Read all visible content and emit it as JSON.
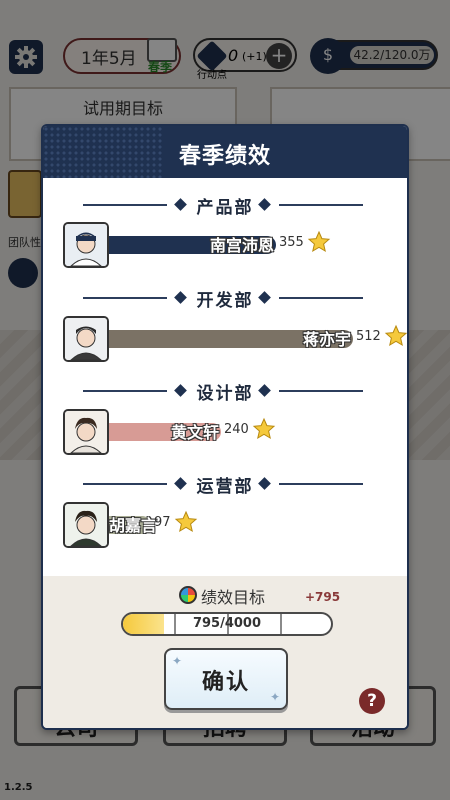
{
  "topbar": {
    "date": "1年5月",
    "season": "春季",
    "points": {
      "value": "0",
      "increment": "(+1)",
      "label": "行动点"
    },
    "money": "42.2/120.0万"
  },
  "goal_card": {
    "title": "试用期目标"
  },
  "side": {
    "label": "团队性"
  },
  "bottom_nav": [
    "公司",
    "招聘",
    "活动"
  ],
  "version": "1.2.5",
  "modal": {
    "title": "春季绩效",
    "departments": [
      {
        "name": "产品部",
        "employee": "南宫沛恩",
        "score": "355",
        "bar_color": "#1f3150",
        "score_fraction": 0.69
      },
      {
        "name": "开发部",
        "employee": "蒋亦宇",
        "score": "512",
        "bar_color": "#7b7265",
        "score_fraction": 1.0
      },
      {
        "name": "设计部",
        "employee": "黄文轩",
        "score": "240",
        "bar_color": "#d79b95",
        "score_fraction": 0.47
      },
      {
        "name": "运营部",
        "employee": "胡嘉言",
        "score": "97",
        "bar_color": "#a9ad95",
        "score_fraction": 0.19
      }
    ],
    "kpi": {
      "label": "绩效目标",
      "increment": "+795",
      "progress_text": "795/4000",
      "progress": 0.1988
    },
    "confirm_label": "确认",
    "help_label": "?"
  },
  "colors": {
    "navy": "#1f3150",
    "accent_red": "#7a2a2a",
    "gold": "#f5c93c"
  }
}
